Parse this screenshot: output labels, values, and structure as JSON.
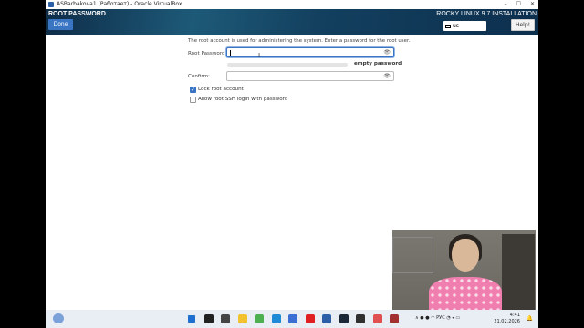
{
  "window": {
    "title": "ASBarbakova1 (Работает) - Oracle VirtualBox",
    "controls": [
      "–",
      "☐",
      "✕"
    ]
  },
  "header": {
    "spoke_title": "ROOT PASSWORD",
    "done_label": "Done",
    "product": "ROCKY LINUX 9.7 INSTALLATION",
    "keyboard_layout": "us",
    "help_label": "Help!"
  },
  "form": {
    "intro": "The root account is used for administering the system.  Enter a password for the root user.",
    "root_password_label": "Root Password:",
    "root_password_value": "",
    "confirm_label": "Confirm:",
    "confirm_value": "",
    "strength_text": "empty password",
    "strength_fraction": 0,
    "lock_root_label": "Lock root account",
    "lock_root_checked": true,
    "allow_ssh_label": "Allow root SSH login with password",
    "allow_ssh_checked": false
  },
  "taskbar": {
    "lang": "РУС",
    "time": "4:41",
    "date": "21.02.2026",
    "apps": [
      "start",
      "search",
      "task-view",
      "file-explorer",
      "chrome",
      "edge",
      "store",
      "youtube",
      "virtualbox",
      "steam",
      "obs",
      "app-1",
      "app-2"
    ],
    "colors": {
      "start": "#1f6fd1",
      "search": "#222222",
      "task-view": "#444444",
      "file-explorer": "#f2c230",
      "chrome": "#4caf50",
      "edge": "#1f8ad6",
      "store": "#3b6fd4",
      "youtube": "#e02020",
      "virtualbox": "#2c5fa8",
      "steam": "#1b2838",
      "obs": "#303030",
      "app-1": "#e05050",
      "app-2": "#a33030"
    }
  },
  "colors": {
    "accent": "#3a75c4",
    "header_bg": "#1c3a5e"
  }
}
